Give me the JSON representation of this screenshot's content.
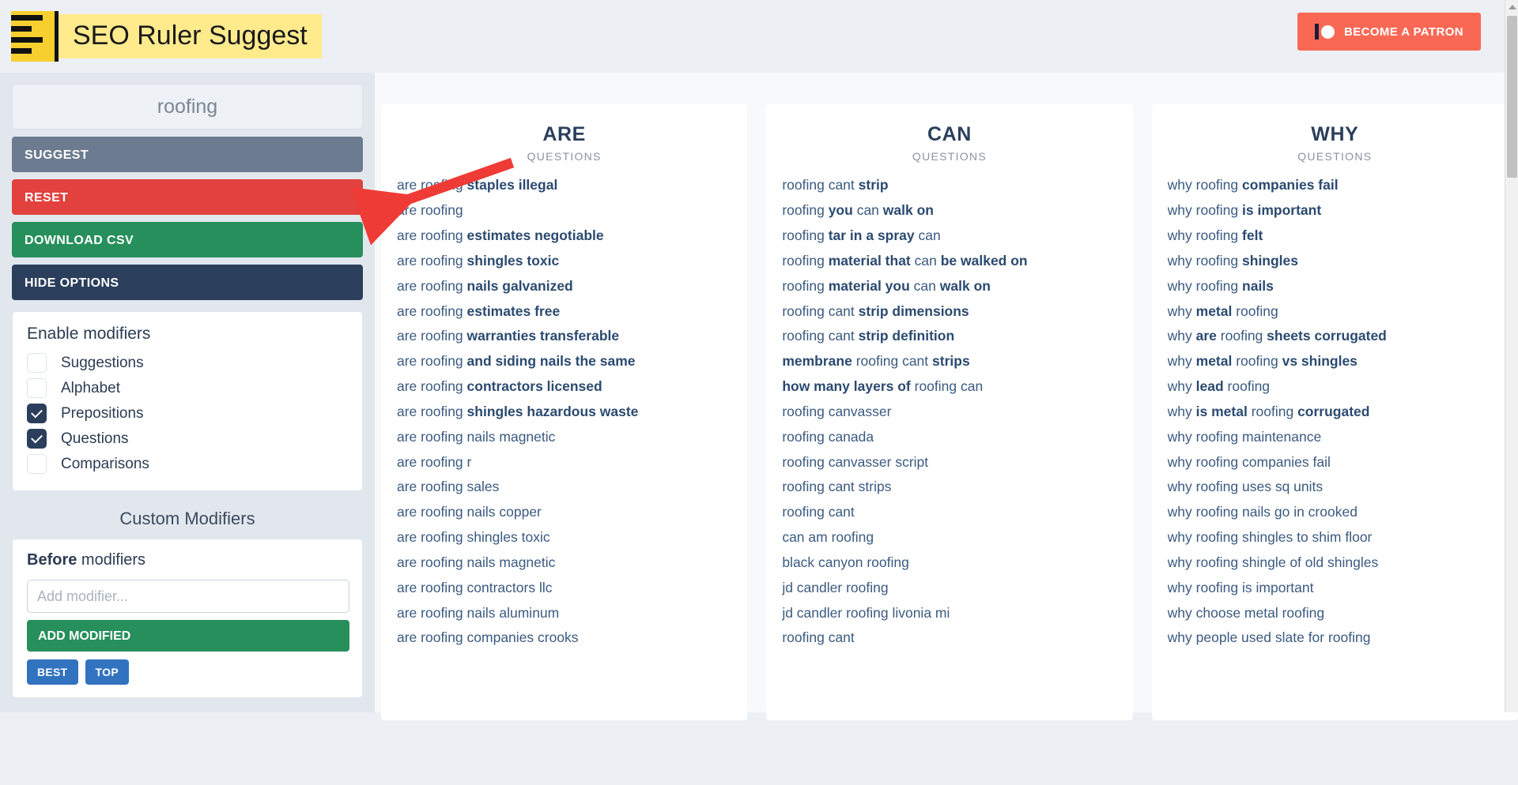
{
  "header": {
    "brand_title": "SEO Ruler Suggest",
    "logo_icon": "ruler-icon",
    "patron_label": "BECOME A PATRON",
    "patron_icon": "patreon-logo-icon",
    "patron_color": "#f96854",
    "brand_highlight_color": "#ffeb8c",
    "logo_color": "#f7cf2e"
  },
  "sidebar": {
    "search_value": "roofing",
    "buttons": [
      {
        "label": "SUGGEST",
        "color": "#6c7b8f"
      },
      {
        "label": "RESET",
        "color": "#e2413d"
      },
      {
        "label": "DOWNLOAD CSV",
        "color": "#268f5b"
      },
      {
        "label": "HIDE OPTIONS",
        "color": "#2b3f5c"
      }
    ],
    "modifiers_title": "Enable modifiers",
    "modifiers": [
      {
        "label": "Suggestions",
        "checked": false
      },
      {
        "label": "Alphabet",
        "checked": false
      },
      {
        "label": "Prepositions",
        "checked": true
      },
      {
        "label": "Questions",
        "checked": true
      },
      {
        "label": "Comparisons",
        "checked": false
      }
    ],
    "custom_title": "Custom Modifiers",
    "before_label_bold": "Before",
    "before_label_rest": " modifiers",
    "add_modifier_placeholder": "Add modifier...",
    "add_modifier_value": "",
    "add_button_label": "ADD MODIFIED",
    "pills": [
      "BEST",
      "TOP"
    ]
  },
  "results": {
    "columns": [
      {
        "title": "ARE",
        "subtitle": "QUESTIONS",
        "items": [
          [
            {
              "t": "are roofing ",
              "b": false
            },
            {
              "t": "staples illegal",
              "b": true
            }
          ],
          [
            {
              "t": "are roofing",
              "b": false
            }
          ],
          [
            {
              "t": "are roofing ",
              "b": false
            },
            {
              "t": "estimates negotiable",
              "b": true
            }
          ],
          [
            {
              "t": "are roofing ",
              "b": false
            },
            {
              "t": "shingles toxic",
              "b": true
            }
          ],
          [
            {
              "t": "are roofing ",
              "b": false
            },
            {
              "t": "nails galvanized",
              "b": true
            }
          ],
          [
            {
              "t": "are roofing ",
              "b": false
            },
            {
              "t": "estimates free",
              "b": true
            }
          ],
          [
            {
              "t": "are roofing ",
              "b": false
            },
            {
              "t": "warranties transferable",
              "b": true
            }
          ],
          [
            {
              "t": "are roofing ",
              "b": false
            },
            {
              "t": "and siding nails the same",
              "b": true
            }
          ],
          [
            {
              "t": "are roofing ",
              "b": false
            },
            {
              "t": "contractors licensed",
              "b": true
            }
          ],
          [
            {
              "t": "are roofing ",
              "b": false
            },
            {
              "t": "shingles hazardous waste",
              "b": true
            }
          ],
          [
            {
              "t": "are roofing nails magnetic",
              "b": false
            }
          ],
          [
            {
              "t": "are roofing r",
              "b": false
            }
          ],
          [
            {
              "t": "are roofing sales",
              "b": false
            }
          ],
          [
            {
              "t": "are roofing nails copper",
              "b": false
            }
          ],
          [
            {
              "t": "are roofing shingles toxic",
              "b": false
            }
          ],
          [
            {
              "t": "are roofing nails magnetic",
              "b": false
            }
          ],
          [
            {
              "t": "are roofing contractors llc",
              "b": false
            }
          ],
          [
            {
              "t": "are roofing nails aluminum",
              "b": false
            }
          ],
          [
            {
              "t": "are roofing companies crooks",
              "b": false
            }
          ]
        ]
      },
      {
        "title": "CAN",
        "subtitle": "QUESTIONS",
        "items": [
          [
            {
              "t": "roofing cant ",
              "b": false
            },
            {
              "t": "strip",
              "b": true
            }
          ],
          [
            {
              "t": "roofing ",
              "b": false
            },
            {
              "t": "you",
              "b": true
            },
            {
              "t": " can ",
              "b": false
            },
            {
              "t": "walk on",
              "b": true
            }
          ],
          [
            {
              "t": "roofing ",
              "b": false
            },
            {
              "t": "tar in a spray",
              "b": true
            },
            {
              "t": " can",
              "b": false
            }
          ],
          [
            {
              "t": "roofing ",
              "b": false
            },
            {
              "t": "material that",
              "b": true
            },
            {
              "t": " can ",
              "b": false
            },
            {
              "t": "be walked on",
              "b": true
            }
          ],
          [
            {
              "t": "roofing ",
              "b": false
            },
            {
              "t": "material you",
              "b": true
            },
            {
              "t": " can ",
              "b": false
            },
            {
              "t": "walk on",
              "b": true
            }
          ],
          [
            {
              "t": "roofing cant ",
              "b": false
            },
            {
              "t": "strip dimensions",
              "b": true
            }
          ],
          [
            {
              "t": "roofing cant ",
              "b": false
            },
            {
              "t": "strip definition",
              "b": true
            }
          ],
          [
            {
              "t": "membrane",
              "b": true
            },
            {
              "t": " roofing cant ",
              "b": false
            },
            {
              "t": "strips",
              "b": true
            }
          ],
          [
            {
              "t": "how many layers of",
              "b": true
            },
            {
              "t": " roofing can",
              "b": false
            }
          ],
          [
            {
              "t": "roofing canvasser",
              "b": false
            }
          ],
          [
            {
              "t": "roofing canada",
              "b": false
            }
          ],
          [
            {
              "t": "roofing canvasser script",
              "b": false
            }
          ],
          [
            {
              "t": "roofing cant strips",
              "b": false
            }
          ],
          [
            {
              "t": "roofing cant",
              "b": false
            }
          ],
          [
            {
              "t": "can am roofing",
              "b": false
            }
          ],
          [
            {
              "t": "black canyon roofing",
              "b": false
            }
          ],
          [
            {
              "t": "jd candler roofing",
              "b": false
            }
          ],
          [
            {
              "t": "jd candler roofing livonia mi",
              "b": false
            }
          ],
          [
            {
              "t": "roofing cant",
              "b": false
            }
          ]
        ]
      },
      {
        "title": "WHY",
        "subtitle": "QUESTIONS",
        "items": [
          [
            {
              "t": "why roofing ",
              "b": false
            },
            {
              "t": "companies fail",
              "b": true
            }
          ],
          [
            {
              "t": "why roofing ",
              "b": false
            },
            {
              "t": "is important",
              "b": true
            }
          ],
          [
            {
              "t": "why roofing ",
              "b": false
            },
            {
              "t": "felt",
              "b": true
            }
          ],
          [
            {
              "t": "why roofing ",
              "b": false
            },
            {
              "t": "shingles",
              "b": true
            }
          ],
          [
            {
              "t": "why roofing ",
              "b": false
            },
            {
              "t": "nails",
              "b": true
            }
          ],
          [
            {
              "t": "why ",
              "b": false
            },
            {
              "t": "metal",
              "b": true
            },
            {
              "t": " roofing",
              "b": false
            }
          ],
          [
            {
              "t": "why ",
              "b": false
            },
            {
              "t": "are",
              "b": true
            },
            {
              "t": " roofing ",
              "b": false
            },
            {
              "t": "sheets corrugated",
              "b": true
            }
          ],
          [
            {
              "t": "why ",
              "b": false
            },
            {
              "t": "metal",
              "b": true
            },
            {
              "t": " roofing ",
              "b": false
            },
            {
              "t": "vs shingles",
              "b": true
            }
          ],
          [
            {
              "t": "why ",
              "b": false
            },
            {
              "t": "lead",
              "b": true
            },
            {
              "t": " roofing",
              "b": false
            }
          ],
          [
            {
              "t": "why ",
              "b": false
            },
            {
              "t": "is metal",
              "b": true
            },
            {
              "t": " roofing ",
              "b": false
            },
            {
              "t": "corrugated",
              "b": true
            }
          ],
          [
            {
              "t": "why roofing maintenance",
              "b": false
            }
          ],
          [
            {
              "t": "why roofing companies fail",
              "b": false
            }
          ],
          [
            {
              "t": "why roofing uses sq units",
              "b": false
            }
          ],
          [
            {
              "t": "why roofing nails go in crooked",
              "b": false
            }
          ],
          [
            {
              "t": "why roofing shingles to shim floor",
              "b": false
            }
          ],
          [
            {
              "t": "why roofing shingle of old shingles",
              "b": false
            }
          ],
          [
            {
              "t": "why roofing is important",
              "b": false
            }
          ],
          [
            {
              "t": "why choose metal roofing",
              "b": false
            }
          ],
          [
            {
              "t": "why people used slate for roofing",
              "b": false
            }
          ]
        ]
      }
    ]
  },
  "annotation": {
    "arrow_color": "#ef3b36",
    "points_to": "suggest-button"
  }
}
